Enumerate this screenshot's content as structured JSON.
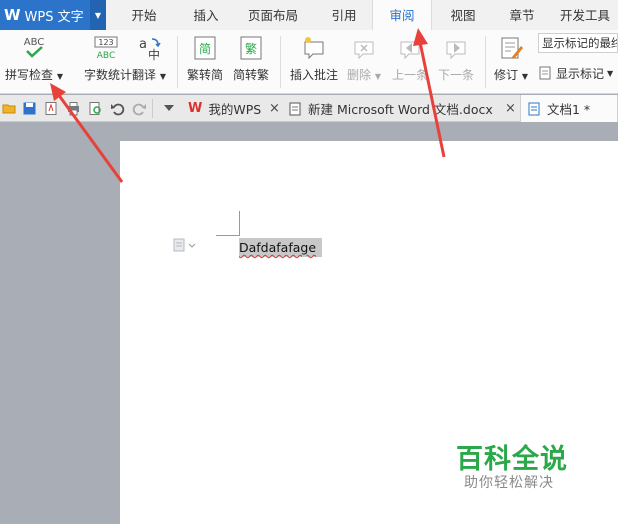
{
  "app": {
    "logo": "W",
    "title": "WPS 文字"
  },
  "menu": {
    "tabs": [
      {
        "label": "开始"
      },
      {
        "label": "插入"
      },
      {
        "label": "页面布局"
      },
      {
        "label": "引用"
      },
      {
        "label": "审阅",
        "active": true
      },
      {
        "label": "视图"
      },
      {
        "label": "章节"
      },
      {
        "label": "开发工具"
      }
    ]
  },
  "ribbon": {
    "spell_check": "拼写检查",
    "spell_icon_text": "ABC",
    "word_count": "字数统计",
    "word_count_icon_top": "123",
    "word_count_icon_bottom": "ABC",
    "translate": "翻译",
    "translate_icon_a": "a",
    "translate_icon_zh": "中",
    "trad_to_simp": "繁转简",
    "trad_icon": "简",
    "simp_to_trad": "简转繁",
    "simp_icon": "繁",
    "insert_comment": "插入批注",
    "delete": "删除",
    "prev": "上一条",
    "next": "下一条",
    "revise": "修订",
    "markup_mode": "显示标记的最终",
    "show_marks": "显示标记"
  },
  "tabsbar": {
    "tabs": [
      {
        "label": "我的WPS"
      },
      {
        "label": "新建 Microsoft Word 文档.docx"
      },
      {
        "label": "文档1 *"
      }
    ],
    "close_glyph": "×"
  },
  "document": {
    "text": "Dafdafafage"
  },
  "watermark": {
    "title": "百科全说",
    "subtitle": "助你轻松解决"
  },
  "colors": {
    "accent": "#2b74c9",
    "arrow": "#e8413a",
    "watermark": "#2aa84a"
  }
}
